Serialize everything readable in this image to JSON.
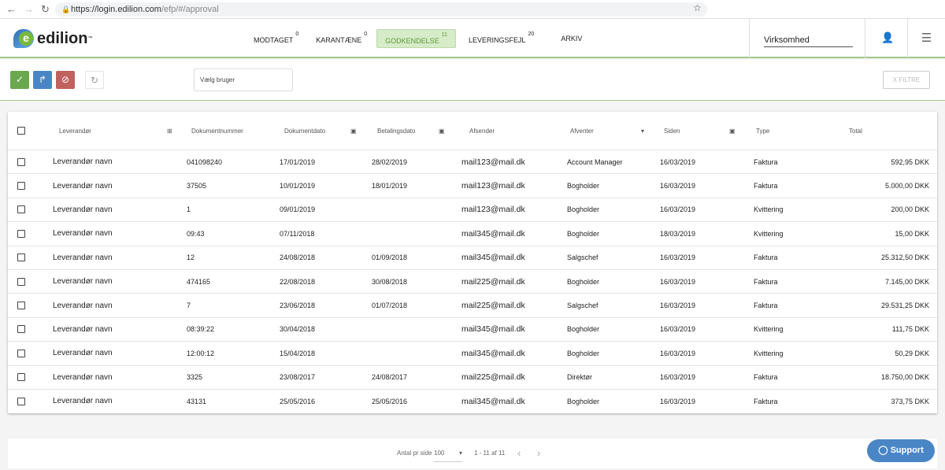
{
  "browser": {
    "url_host": "https://login.edilion.com",
    "url_path": "/efp/#/approval"
  },
  "logo": {
    "text": "edilion"
  },
  "tabs": [
    {
      "label": "MODTAGET",
      "count": "0"
    },
    {
      "label": "KARANTÆNE",
      "count": "0"
    },
    {
      "label": "GODKENDELSE",
      "count": "11"
    },
    {
      "label": "LEVERINGSFEJL",
      "count": "20"
    },
    {
      "label": "ARKIV",
      "count": ""
    }
  ],
  "company": "Virksomhed",
  "toolbar": {
    "user_placeholder": "Vælg bruger",
    "filter_label": "X FILTRE"
  },
  "columns": [
    "Leverandør",
    "Dokumentnummer",
    "Dokumentdato",
    "Betalingsdato",
    "Afsender",
    "Afventer",
    "Siden",
    "Type",
    "Total"
  ],
  "rows": [
    {
      "lev": "Leverandør navn",
      "doc": "041098240",
      "dd": "17/01/2019",
      "bd": "28/02/2019",
      "af": "mail123@mail.dk",
      "av": "Account Manager",
      "si": "16/03/2019",
      "ty": "Faktura",
      "to": "592,95 DKK"
    },
    {
      "lev": "Leverandør navn",
      "doc": "37505",
      "dd": "10/01/2019",
      "bd": "18/01/2019",
      "af": "mail123@mail.dk",
      "av": "Bogholder",
      "si": "16/03/2019",
      "ty": "Faktura",
      "to": "5.000,00 DKK"
    },
    {
      "lev": "Leverandør navn",
      "doc": "1",
      "dd": "09/01/2019",
      "bd": "",
      "af": "mail123@mail.dk",
      "av": "Bogholder",
      "si": "16/03/2019",
      "ty": "Kvittering",
      "to": "200,00 DKK"
    },
    {
      "lev": "Leverandør navn",
      "doc": "09:43",
      "dd": "07/11/2018",
      "bd": "",
      "af": "mail345@mail.dk",
      "av": "Bogholder",
      "si": "18/03/2019",
      "ty": "Kvittering",
      "to": "15,00 DKK"
    },
    {
      "lev": "Leverandør navn",
      "doc": "12",
      "dd": "24/08/2018",
      "bd": "01/09/2018",
      "af": "mail345@mail.dk",
      "av": "Salgschef",
      "si": "16/03/2019",
      "ty": "Faktura",
      "to": "25.312,50 DKK"
    },
    {
      "lev": "Leverandør navn",
      "doc": "474165",
      "dd": "22/08/2018",
      "bd": "30/08/2018",
      "af": "mail225@mail.dk",
      "av": "Bogholder",
      "si": "16/03/2019",
      "ty": "Faktura",
      "to": "7.145,00 DKK"
    },
    {
      "lev": "Leverandør navn",
      "doc": "7",
      "dd": "23/06/2018",
      "bd": "01/07/2018",
      "af": "mail225@mail.dk",
      "av": "Salgschef",
      "si": "16/03/2019",
      "ty": "Faktura",
      "to": "29.531,25 DKK"
    },
    {
      "lev": "Leverandør navn",
      "doc": "08:39:22",
      "dd": "30/04/2018",
      "bd": "",
      "af": "mail345@mail.dk",
      "av": "Bogholder",
      "si": "16/03/2019",
      "ty": "Kvittering",
      "to": "111,75 DKK"
    },
    {
      "lev": "Leverandør navn",
      "doc": "12:00:12",
      "dd": "15/04/2018",
      "bd": "",
      "af": "mail345@mail.dk",
      "av": "Bogholder",
      "si": "16/03/2019",
      "ty": "Kvittering",
      "to": "50,29 DKK"
    },
    {
      "lev": "Leverandør navn",
      "doc": "3325",
      "dd": "23/08/2017",
      "bd": "24/08/2017",
      "af": "mail225@mail.dk",
      "av": "Direktør",
      "si": "16/03/2019",
      "ty": "Faktura",
      "to": "18.750,00 DKK"
    },
    {
      "lev": "Leverandør navn",
      "doc": "43131",
      "dd": "25/05/2016",
      "bd": "25/05/2016",
      "af": "mail345@mail.dk",
      "av": "Bogholder",
      "si": "16/03/2019",
      "ty": "Faktura",
      "to": "373,75 DKK"
    }
  ],
  "pagination": {
    "per_page_label": "Antal pr side",
    "per_page": "100",
    "range": "1 - 11 af 11"
  },
  "support": "Support",
  "colors": {
    "approve": "#6aa84f",
    "forward": "#4a86c5",
    "reject": "#c0625e",
    "accent": "#9fc88a"
  }
}
